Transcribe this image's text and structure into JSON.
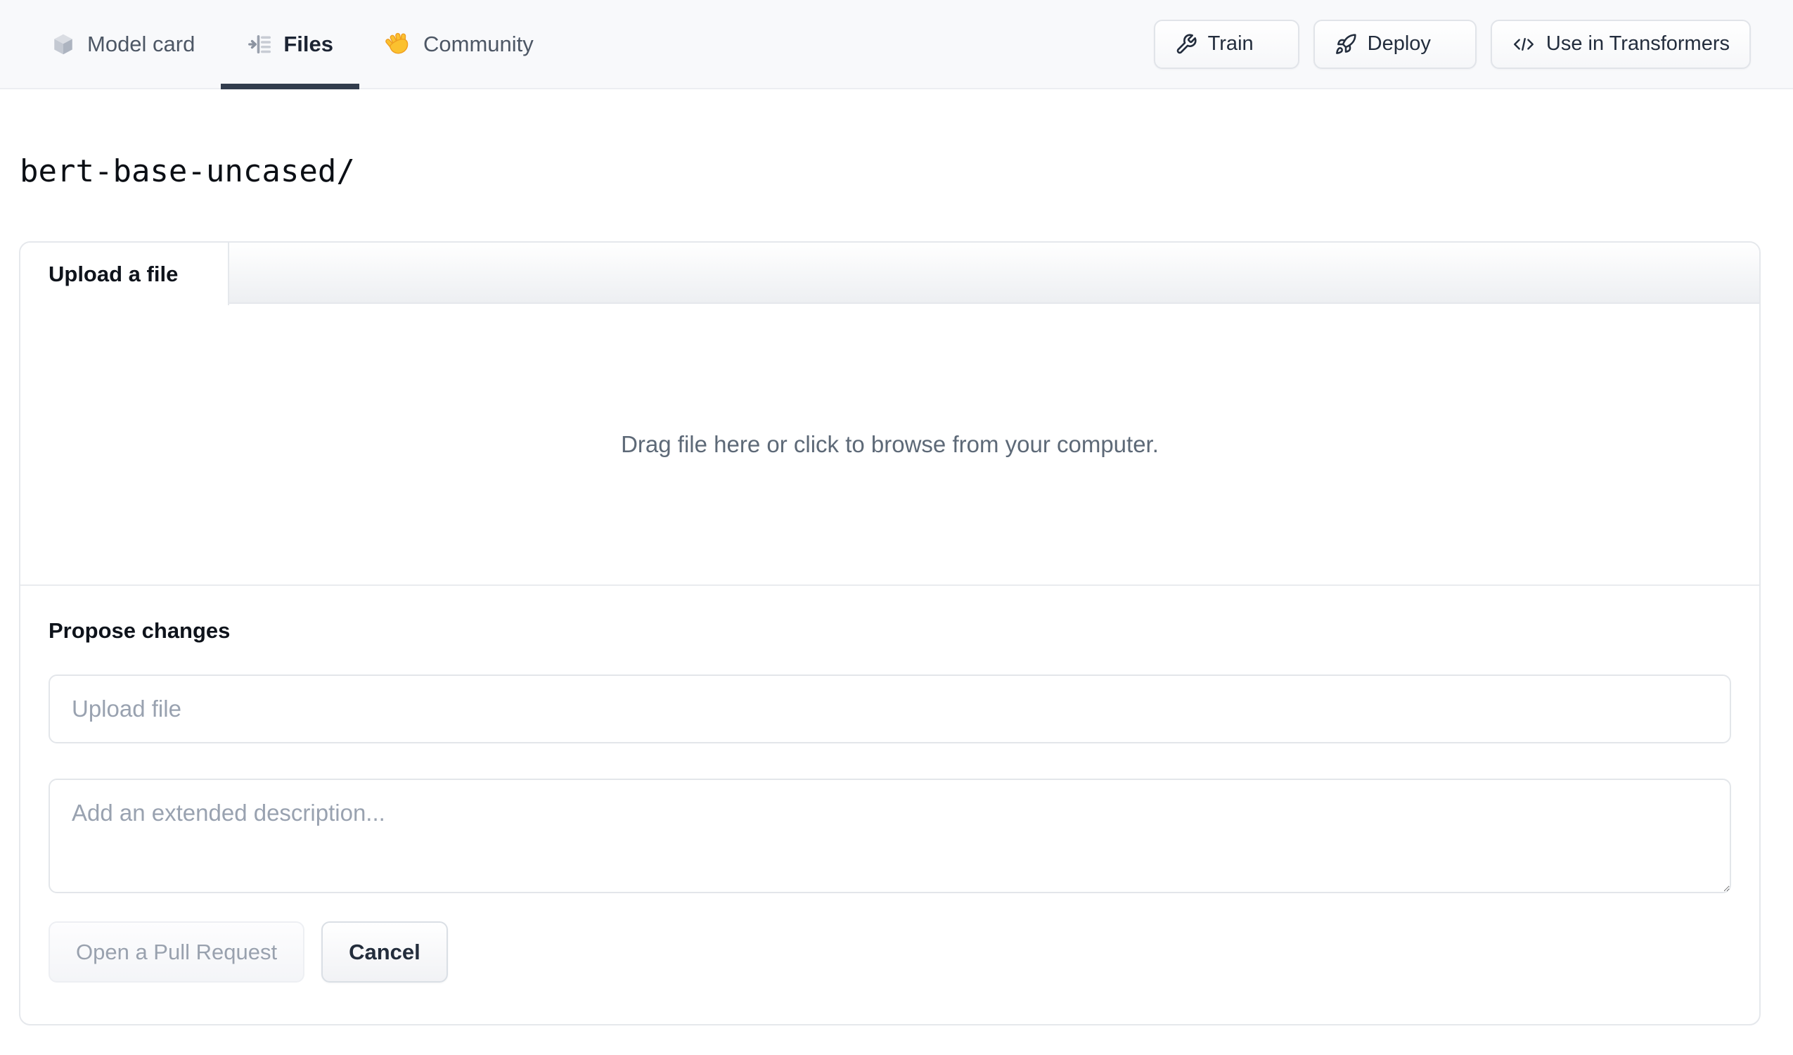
{
  "nav": {
    "tabs": [
      {
        "label": "Model card",
        "icon": "cube-icon",
        "active": false
      },
      {
        "label": "Files",
        "icon": "file-tree-icon",
        "active": true
      },
      {
        "label": "Community",
        "icon": "waving-hand-icon",
        "active": false
      }
    ],
    "actions": [
      {
        "label": "Train",
        "icon": "wrench-icon",
        "has_dropdown": true
      },
      {
        "label": "Deploy",
        "icon": "rocket-icon",
        "has_dropdown": true
      },
      {
        "label": "Use in Transformers",
        "icon": "code-icon",
        "has_dropdown": false
      }
    ]
  },
  "repo_path": "bert-base-uncased/",
  "upload_card": {
    "tab_label": "Upload a file",
    "dropzone_text": "Drag file here or click to browse from your computer.",
    "propose_heading": "Propose changes",
    "filename_placeholder": "Upload file",
    "description_placeholder": "Add an extended description...",
    "submit_label": "Open a Pull Request",
    "submit_disabled": true,
    "cancel_label": "Cancel"
  },
  "colors": {
    "navbar_bg": "#f8f9fb",
    "active_tab_underline": "#323d4d",
    "nav_text": "#4d5765",
    "dark_text": "#0e131b",
    "muted_text": "#5d6977",
    "placeholder_text": "#99a2b0",
    "border": "#e5e8ec",
    "disabled_button_text": "#99a1ae",
    "hand_emoji_yellow": "#fbc12f"
  }
}
